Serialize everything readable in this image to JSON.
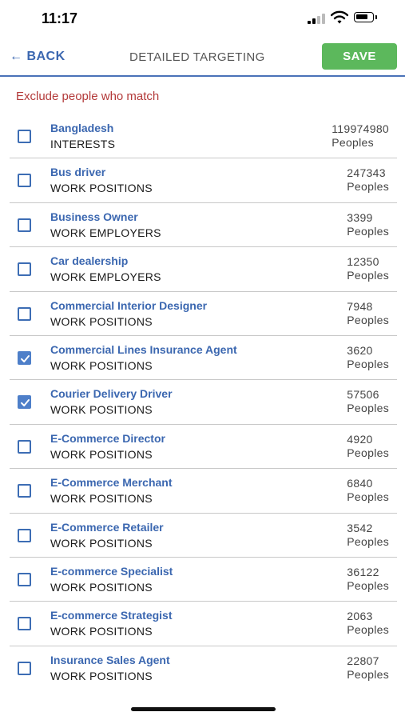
{
  "status": {
    "time": "11:17"
  },
  "nav": {
    "back_label": "← BACK",
    "title": "DETAILED TARGETING",
    "save_label": "SAVE"
  },
  "section_label": "Exclude people who match",
  "items": [
    {
      "name": "Bangladesh",
      "type": "INTERESTS",
      "count": "119974980",
      "unit": "Peoples",
      "checked": false
    },
    {
      "name": "Bus driver",
      "type": "WORK POSITIONS",
      "count": "247343",
      "unit": "Peoples",
      "checked": false
    },
    {
      "name": "Business Owner",
      "type": "WORK EMPLOYERS",
      "count": "3399",
      "unit": "Peoples",
      "checked": false
    },
    {
      "name": "Car dealership",
      "type": "WORK EMPLOYERS",
      "count": "12350",
      "unit": "Peoples",
      "checked": false
    },
    {
      "name": "Commercial Interior Designer",
      "type": "WORK POSITIONS",
      "count": "7948",
      "unit": "Peoples",
      "checked": false
    },
    {
      "name": "Commercial Lines Insurance Agent",
      "type": "WORK POSITIONS",
      "count": "3620",
      "unit": "Peoples",
      "checked": true
    },
    {
      "name": "Courier Delivery Driver",
      "type": "WORK POSITIONS",
      "count": "57506",
      "unit": "Peoples",
      "checked": true
    },
    {
      "name": "E-Commerce Director",
      "type": "WORK POSITIONS",
      "count": "4920",
      "unit": "Peoples",
      "checked": false
    },
    {
      "name": "E-Commerce Merchant",
      "type": "WORK POSITIONS",
      "count": "6840",
      "unit": "Peoples",
      "checked": false
    },
    {
      "name": "E-Commerce Retailer",
      "type": "WORK POSITIONS",
      "count": "3542",
      "unit": "Peoples",
      "checked": false
    },
    {
      "name": "E-commerce Specialist",
      "type": "WORK POSITIONS",
      "count": "36122",
      "unit": "Peoples",
      "checked": false
    },
    {
      "name": "E-commerce Strategist",
      "type": "WORK POSITIONS",
      "count": "2063",
      "unit": "Peoples",
      "checked": false
    },
    {
      "name": "Insurance Sales Agent",
      "type": "WORK POSITIONS",
      "count": "22807",
      "unit": "Peoples",
      "checked": false
    }
  ]
}
